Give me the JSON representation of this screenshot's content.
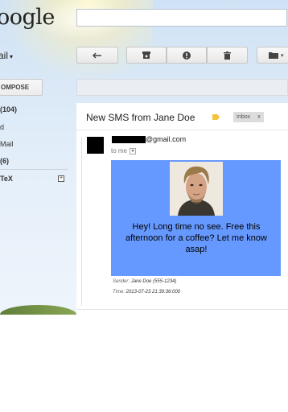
{
  "header": {
    "logo_text": "oogle"
  },
  "sidebar": {
    "mail_label": "ail",
    "compose_label": "OMPOSE",
    "items": [
      {
        "label": "(104)",
        "bold": true
      },
      {
        "label": "d",
        "bold": false
      },
      {
        "label": "Mail",
        "bold": false
      },
      {
        "label": "(6)",
        "bold": true
      },
      {
        "label": "TeX",
        "bold": true
      }
    ],
    "plus_icon": "+"
  },
  "toolbar": {
    "back_icon": "reply-arrow-icon",
    "archive_icon": "archive-icon",
    "spam_icon": "report-spam-icon",
    "delete_icon": "trash-icon",
    "move_icon": "folder-icon"
  },
  "message": {
    "subject": "New SMS from Jane Doe",
    "inbox_label": "Inbox",
    "inbox_remove": "x",
    "sender_domain": "@gmail.com",
    "to_me": "to me",
    "sms_text": "Hey! Long time no see. Free this afternoon for a coffee? Let me know asap!",
    "sender_key": "Sender:",
    "sender_value": "Jane Doe (555-1234)",
    "time_key": "Time:",
    "time_value": "2013-07-23 21:39:36:000"
  },
  "colors": {
    "sms_background": "#6699ff",
    "label_tag": "#f6c33b"
  }
}
